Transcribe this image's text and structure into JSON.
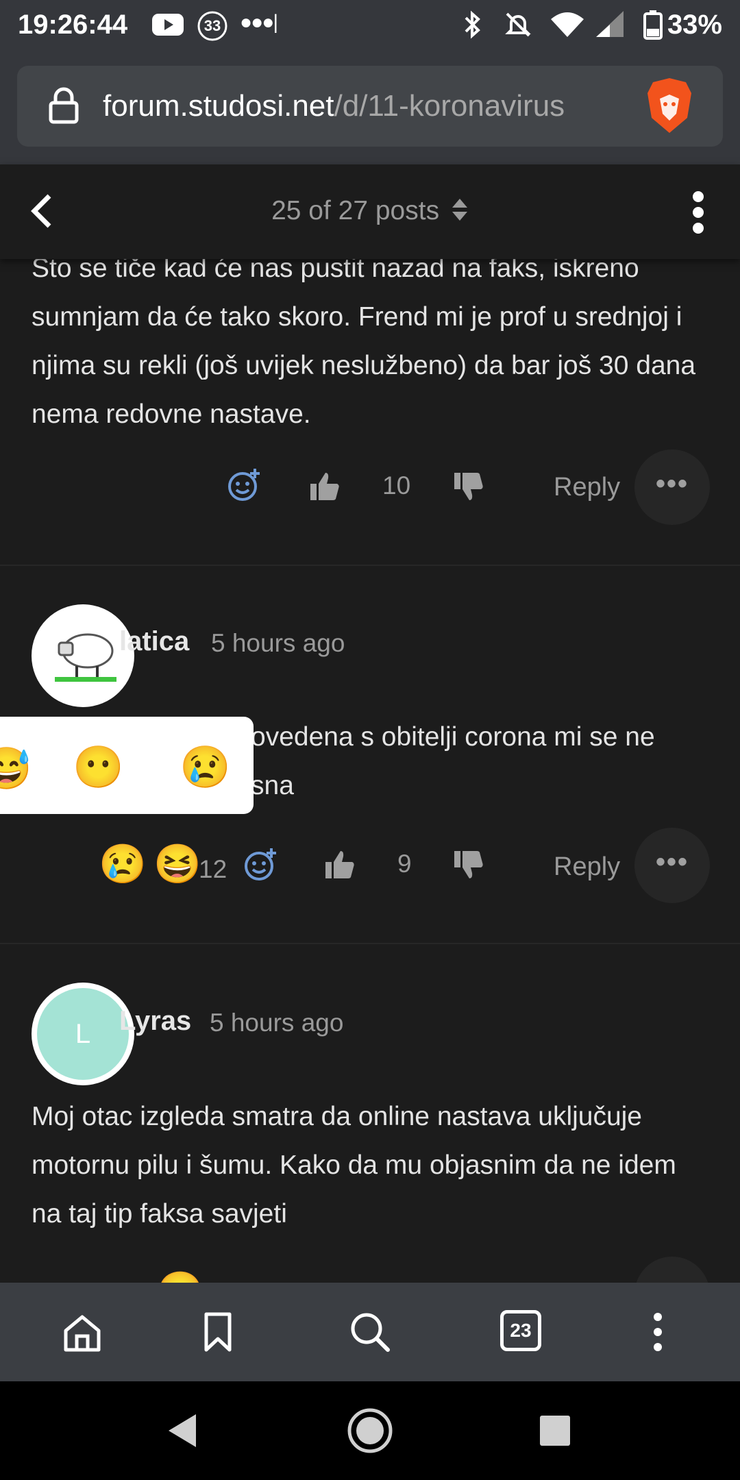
{
  "status": {
    "time": "19:26:44",
    "notification_count": "33",
    "battery": "33%"
  },
  "browser": {
    "url_domain": "forum.studosi.net",
    "url_path": "/d/11-koronavirus",
    "tab_count": "23"
  },
  "header": {
    "posts_counter": "25 of 27 posts"
  },
  "posts": [
    {
      "text": "Što se tiče kad će nas pustit nazad na faks, iskreno sumnjam da će tako skoro. Frend mi je prof u srednjoj i njima su rekli (još uvijek neslužbeno) da bar još 30 dana nema redovne nastave.",
      "likes": "10",
      "reply_label": "Reply"
    },
    {
      "author": "latica",
      "time": "5 hours ago",
      "text_line1": "ovedena s obitelji corona mi se ne",
      "text_line2": "sna",
      "reaction_count": "12",
      "likes": "9",
      "reply_label": "Reply",
      "reactions": [
        "😢",
        "😆"
      ]
    },
    {
      "author": "Lyras",
      "avatar_letter": "L",
      "time": "5 hours ago",
      "text": "Moj otac izgleda smatra da online nastava uključuje motornu pilu i šumu. Kako da mu objasnim da ne idem na taj tip faksa savjeti"
    }
  ],
  "reaction_popup": {
    "emojis": [
      "😶",
      "😢"
    ]
  },
  "colors": {
    "background": "#1c1c1c",
    "toolbar": "#35373c",
    "brave_orange": "#f2531c",
    "lyras_avatar": "#a4e3d5"
  }
}
